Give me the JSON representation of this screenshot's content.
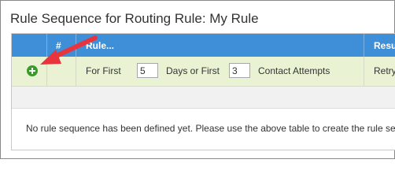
{
  "page": {
    "title": "Rule Sequence for Routing Rule: My Rule"
  },
  "table": {
    "columns": [
      {
        "key": "action",
        "label": ""
      },
      {
        "key": "number",
        "label": "#"
      },
      {
        "key": "rule",
        "label": "Rule..."
      },
      {
        "key": "result",
        "label": "Resul"
      }
    ],
    "new_row": {
      "add_icon": "plus-circle-icon",
      "for_first_label": "For First",
      "days_value": "5",
      "days_or_first_label": "Days or First",
      "attempts_value": "3",
      "contact_attempts_label": "Contact Attempts",
      "result_text": "Retry"
    },
    "empty_message": "No rule sequence has been defined yet. Please use the above table to create the rule seq"
  },
  "annotation": {
    "icon": "arrow-annotation-icon",
    "color": "#e8343d"
  },
  "colors": {
    "header_bg": "#3f8fd8",
    "row_bg": "#e9f3d4",
    "add_icon": "#3a9a2c"
  }
}
